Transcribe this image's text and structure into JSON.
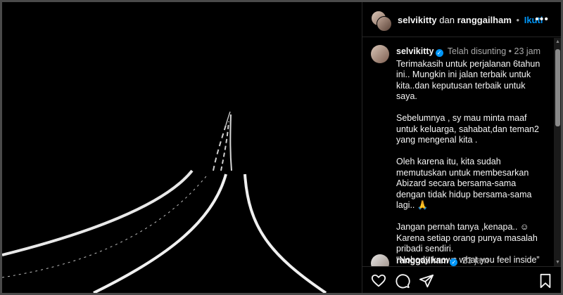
{
  "header": {
    "user1": "selvikitty",
    "joiner": "dan",
    "user2": "ranggailham",
    "dot": "•",
    "follow_label": "Ikuti",
    "more_icon": "more-horizontal-icon"
  },
  "caption": {
    "username": "selvikitty",
    "verified_icon": "verified-badge-icon",
    "edited_label": "Telah disunting",
    "dot": "•",
    "time": "23 jam",
    "body": "Terimakasih untuk perjalanan 6tahun ini.. Mungkin ini jalan terbaik untuk kita..dan keputusan terbaik untuk saya.\n\nSebelumnya , sy mau minta maaf untuk keluarga, sahabat,dan teman2 yang mengenal kita .\n\nOleh karena itu, kita sudah memutuskan untuk membesarkan Abizard secara bersama-sama dengan tidak hidup bersama-sama lagi.. 🙏\n\nJangan pernah tanya ,kenapa.. ☺\nKarena setiap orang punya masalah pribadi sendiri.\n“Nobody knows what you feel inside”"
  },
  "comment2": {
    "username": "ranggailham",
    "verified_icon": "verified-badge-icon",
    "time": "23 jam"
  },
  "actions": {
    "icons": [
      "heart-icon",
      "comment-icon",
      "share-icon",
      "bookmark-icon"
    ]
  },
  "colors": {
    "background": "#000000",
    "accent_blue": "#0095f6",
    "muted_text": "#a8a8a8",
    "divider": "#262626"
  }
}
